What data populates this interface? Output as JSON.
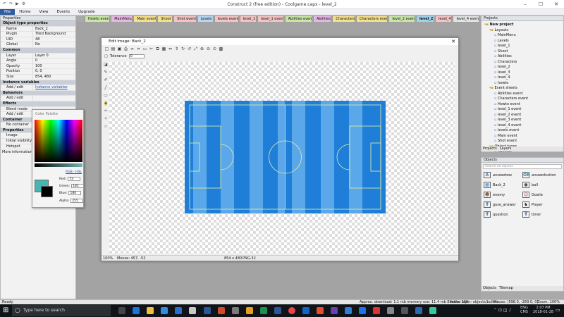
{
  "app": {
    "title": "Construct 2  (free edition) - Coolgame.capx - level_2"
  },
  "ribbon": {
    "tabs": [
      "File",
      "Home",
      "View",
      "Events",
      "Upgrade"
    ]
  },
  "doc_tabs": [
    {
      "label": "Howto event",
      "color": "#c9e6a7"
    },
    {
      "label": "MainMenu",
      "color": "#e7b6e3"
    },
    {
      "label": "Main event",
      "color": "#f4e08a"
    },
    {
      "label": "Shoot",
      "color": "#f4e08a"
    },
    {
      "label": "Shot event",
      "color": "#f5c3c3"
    },
    {
      "label": "Levels",
      "color": "#b7d6f0"
    },
    {
      "label": "levels event",
      "color": "#f5c3c3"
    },
    {
      "label": "level_1",
      "color": "#f5c3c3"
    },
    {
      "label": "level_1 event",
      "color": "#f5c3c3"
    },
    {
      "label": "Abilities event",
      "color": "#c9e6a7"
    },
    {
      "label": "Abilities",
      "color": "#e7b6e3"
    },
    {
      "label": "Characters",
      "color": "#f4e08a"
    },
    {
      "label": "Characters event",
      "color": "#f4e08a"
    },
    {
      "label": "level_2 event",
      "color": "#c9e6a7"
    },
    {
      "label": "level_2",
      "color": "#9fd3ee"
    },
    {
      "label": "level_4",
      "color": "#f5c3c3"
    },
    {
      "label": "level_4 event",
      "color": "#e3e3e3"
    }
  ],
  "properties": {
    "header": "Properties",
    "rows": [
      {
        "type": "sec",
        "k": "Object type properties"
      },
      {
        "k": "Name",
        "v": "Back_2"
      },
      {
        "k": "Plugin",
        "v": "Tiled Background"
      },
      {
        "k": "UID",
        "v": "48"
      },
      {
        "k": "Global",
        "v": "No"
      },
      {
        "type": "sec",
        "k": "Common"
      },
      {
        "k": "Layer",
        "v": "Layer 0"
      },
      {
        "k": "Angle",
        "v": "0"
      },
      {
        "k": "Opacity",
        "v": "100"
      },
      {
        "k": "Position",
        "v": "0, 0"
      },
      {
        "k": "Size",
        "v": "854, 480"
      },
      {
        "type": "sec",
        "k": "Instance variables"
      },
      {
        "k": "Add / edit",
        "v": "Instance variables",
        "link": true
      },
      {
        "type": "sec",
        "k": "Behaviors"
      },
      {
        "k": "Add / edit",
        "v": ""
      },
      {
        "type": "sec",
        "k": "Effects"
      },
      {
        "k": "Blend mode",
        "v": ""
      },
      {
        "k": "Add / edit",
        "v": ""
      },
      {
        "type": "sec",
        "k": "Container"
      },
      {
        "k": "No container",
        "v": ""
      },
      {
        "type": "sec",
        "k": "Properties"
      },
      {
        "k": "Image",
        "v": ""
      },
      {
        "k": "Initial visibility",
        "v": ""
      },
      {
        "k": "Hotspot",
        "v": ""
      }
    ],
    "more": "More information"
  },
  "editor": {
    "title": "Edit image: Back_2",
    "tolerance_label": "Tolerance",
    "tolerance_value": "0",
    "status_zoom": "100%",
    "status_mouse": "Mouse: 457, -52",
    "status_size": "854 x 480",
    "status_format": "PNG-32"
  },
  "palette": {
    "title": "Color Palette",
    "mode": "RGB - HSL",
    "red_label": "Red:",
    "red": "73",
    "green_label": "Green:",
    "green": "181",
    "blue_label": "Blue:",
    "blue": "180",
    "alpha_label": "Alpha:",
    "alpha": "255",
    "fg": "#48b5b0",
    "bg": "#000000"
  },
  "project": {
    "header": "Projects",
    "tree": [
      {
        "label": "New project",
        "depth": 0,
        "bold": true
      },
      {
        "label": "Layouts",
        "depth": 1
      },
      {
        "label": "MainMenu",
        "depth": 2
      },
      {
        "label": "Levels",
        "depth": 2
      },
      {
        "label": "level_1",
        "depth": 2
      },
      {
        "label": "Shoot",
        "depth": 2
      },
      {
        "label": "Abilities",
        "depth": 2
      },
      {
        "label": "Characters",
        "depth": 2
      },
      {
        "label": "level_2",
        "depth": 2
      },
      {
        "label": "level_3",
        "depth": 2
      },
      {
        "label": "level_4",
        "depth": 2
      },
      {
        "label": "howto",
        "depth": 2
      },
      {
        "label": "Event sheets",
        "depth": 1
      },
      {
        "label": "Abilities event",
        "depth": 2
      },
      {
        "label": "Characters event",
        "depth": 2
      },
      {
        "label": "Howto event",
        "depth": 2
      },
      {
        "label": "level_1 event",
        "depth": 2
      },
      {
        "label": "level_2 event",
        "depth": 2
      },
      {
        "label": "level_3 event",
        "depth": 2
      },
      {
        "label": "level_4 event",
        "depth": 2
      },
      {
        "label": "levels event",
        "depth": 2
      },
      {
        "label": "Main event",
        "depth": 2
      },
      {
        "label": "Shot event",
        "depth": 2
      },
      {
        "label": "Object types",
        "depth": 1
      },
      {
        "label": "Abilities",
        "depth": 2
      }
    ],
    "bottom_tabs": [
      "Projects",
      "Layers"
    ]
  },
  "objects": {
    "header": "Objects",
    "search_placeholder": "Search all objects",
    "items": [
      {
        "label": "answerbox",
        "icon": "A",
        "color": "#3b7fd1"
      },
      {
        "label": "answerbutton",
        "icon": "OK",
        "color": "#2a8aa0"
      },
      {
        "label": "Back_2",
        "icon": "▦",
        "color": "#3a86d6"
      },
      {
        "label": "ball",
        "icon": "●",
        "color": "#555"
      },
      {
        "label": "enemy",
        "icon": "☻",
        "color": "#7a4b2a"
      },
      {
        "label": "Goalie",
        "icon": "☺",
        "color": "#c44"
      },
      {
        "label": "guse_answer",
        "icon": "T",
        "color": "#1a4e8a"
      },
      {
        "label": "Player",
        "icon": "♞",
        "color": "#222"
      },
      {
        "label": "question",
        "icon": "T",
        "color": "#1a4e8a"
      },
      {
        "label": "timer",
        "icon": "T",
        "color": "#1a4e8a"
      }
    ],
    "bottom_tabs": [
      "Objects",
      "Tilemap"
    ]
  },
  "status": {
    "ready": "Ready",
    "download": "Approx. download: 1.1 mb  memory use: 11.4 mb  Events: 106",
    "layer": "Active layer: objects/bullets",
    "mouse": "Mouse: (598.0, -289.0, 0)",
    "zoom": "Zoom: 100%"
  },
  "taskbar": {
    "search": "Type here to search",
    "lang": "ENG",
    "region": "CMS",
    "time": "2:07 PM",
    "date": "2018-01-28"
  }
}
